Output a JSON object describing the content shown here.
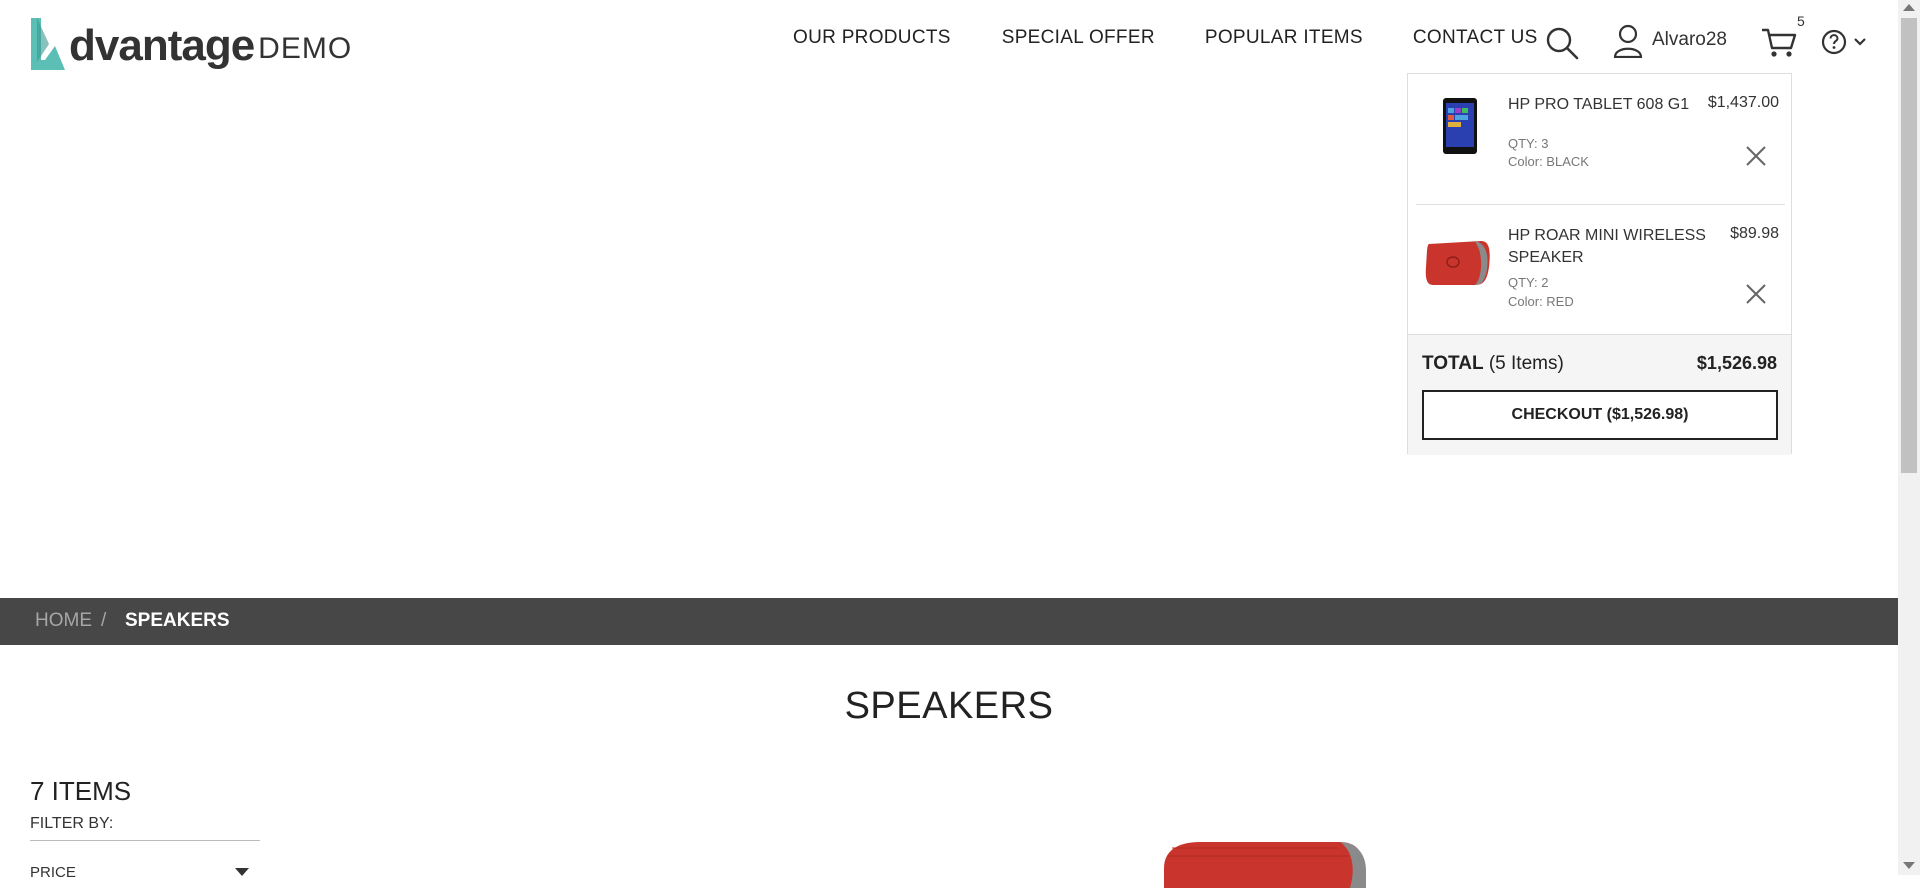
{
  "logo": {
    "word": "dvantage",
    "demo": "DEMO"
  },
  "nav": {
    "items": [
      "OUR PRODUCTS",
      "SPECIAL OFFER",
      "POPULAR ITEMS",
      "CONTACT US"
    ]
  },
  "header": {
    "username": "Alvaro28",
    "cart_count": "5",
    "icons": [
      "search-icon",
      "user-icon",
      "cart-icon",
      "help-icon",
      "chevron-down-icon"
    ]
  },
  "cart": {
    "items": [
      {
        "name": "HP PRO TABLET 608 G1",
        "price": "$1,437.00",
        "qty": "QTY: 3",
        "color": "Color: BLACK"
      },
      {
        "name": "HP ROAR MINI WIRELESS SPEAKER",
        "price": "$89.98",
        "qty": "QTY: 2",
        "color": "Color: RED"
      }
    ],
    "total_label": "TOTAL",
    "total_items": "(5 Items)",
    "total_value": "$1,526.98",
    "checkout_label": "CHECKOUT ($1,526.98)"
  },
  "breadcrumb": {
    "home": "HOME",
    "separator": "/",
    "current": "SPEAKERS"
  },
  "page": {
    "title": "SPEAKERS",
    "item_count": "7 ITEMS",
    "filter_by": "FILTER BY:",
    "filter_price": "PRICE"
  },
  "colors": {
    "logo_teal": "#5bbfb5",
    "breadcrumb_bg": "#474747",
    "speaker_red": "#c9352c"
  }
}
